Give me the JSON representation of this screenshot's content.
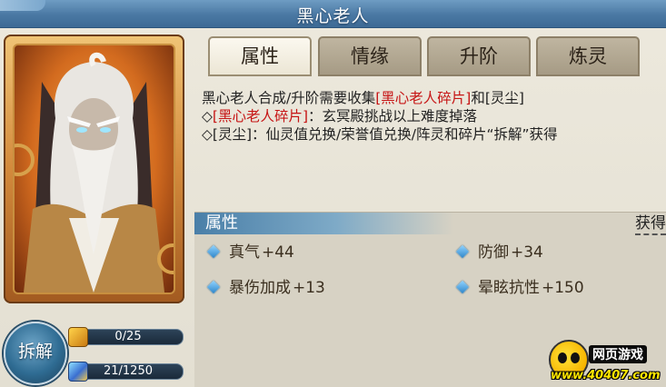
{
  "window": {
    "title": "黑心老人"
  },
  "tabs": [
    {
      "label": "属性",
      "active": true
    },
    {
      "label": "情缘",
      "active": false
    },
    {
      "label": "升阶",
      "active": false
    },
    {
      "label": "炼灵",
      "active": false
    }
  ],
  "description": {
    "line1_prefix": "黑心老人合成/升阶需要收集",
    "line1_highlight": "[黑心老人碎片]",
    "line1_suffix": "和[灵尘]",
    "line2_bullet": "◇",
    "line2_highlight": "[黑心老人碎片]",
    "line2_text": "：玄冥殿挑战以上难度掉落",
    "line3_text": "◇[灵尘]：仙灵值兑换/荣誉值兑换/阵灵和碎片“拆解”获得"
  },
  "attributes": {
    "header_label": "属性",
    "obtain_link": "获得",
    "stats": [
      {
        "name": "真气",
        "value": "+44"
      },
      {
        "name": "防御",
        "value": "+34"
      },
      {
        "name": "暴伤加成",
        "value": "+13"
      },
      {
        "name": "晕眩抗性",
        "value": "+150"
      }
    ]
  },
  "left_panel": {
    "dismantle_label": "拆解",
    "fragments": {
      "text": "0/25",
      "current": 0,
      "required": 25
    },
    "dust": {
      "text": "21/1250",
      "current": 21,
      "required": 1250
    }
  },
  "watermark": {
    "brand_text": "网页游戏",
    "url_text": "www.40407.com"
  },
  "colors": {
    "title_bar": "#4a78a3",
    "highlight_red": "#c61414",
    "card_gold": "#d38a3c",
    "stat_diamond": "#2f86c9"
  },
  "icons": {
    "fragment_icon": "puzzle-piece",
    "dust_icon": "spirit-dust-crystal",
    "stat_bullet": "blue-diamond",
    "character": "white-haired-elder-portrait"
  }
}
